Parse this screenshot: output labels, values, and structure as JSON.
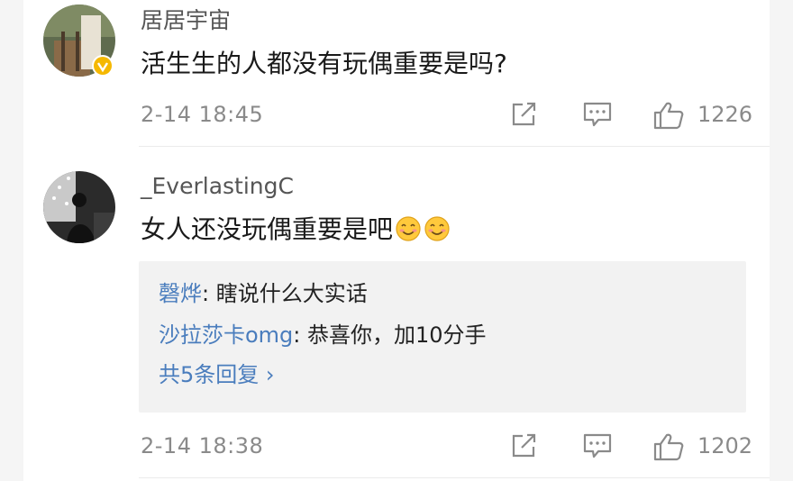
{
  "comments": [
    {
      "username": "居居宇宙",
      "text": "活生生的人都没有玩偶重要是吗?",
      "time": "2-14 18:45",
      "likes": "1226",
      "verified": true,
      "icons": [
        "share-icon",
        "comment-icon",
        "like-icon"
      ]
    },
    {
      "username": "_EverlastingC",
      "text": "女人还没玩偶重要是吧",
      "emoji": [
        "smile-emoji",
        "smile-emoji"
      ],
      "time": "2-14 18:38",
      "likes": "1202",
      "replies": [
        {
          "name": "磬烨",
          "text": ": 瞎说什么大实话"
        },
        {
          "name": "沙拉莎卡omg",
          "text": ": 恭喜你，加10分手"
        }
      ],
      "more_replies": "共5条回复 ›"
    }
  ],
  "colors": {
    "link": "#4a7dbd",
    "meta": "#8a8a8a",
    "verified_badge": "#f5b800"
  }
}
